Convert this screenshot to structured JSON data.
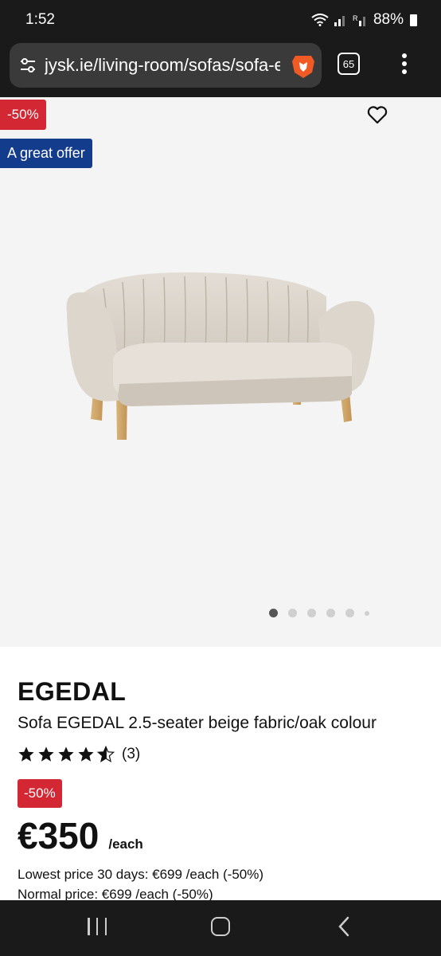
{
  "status_bar": {
    "time": "1:52",
    "battery": "88%"
  },
  "browser": {
    "url": "jysk.ie/living-room/sofas/sofa-egedal",
    "tab_count": "65"
  },
  "product": {
    "badge_discount": "-50%",
    "badge_offer": "A great offer",
    "gallery": {
      "image_count": 6,
      "active_index": 0
    },
    "brand": "EGEDAL",
    "title": "Sofa EGEDAL 2.5-seater beige fabric/oak colour",
    "rating": {
      "stars": 4.5,
      "count_text": "(3)"
    },
    "price_badge": "-50%",
    "price": "€350",
    "price_unit": "/each",
    "lowest_price": "Lowest price 30 days: €699 /each (-50%)",
    "normal_price": "Normal price: €699 /each (-50%)"
  },
  "colors": {
    "discount_red": "#d32733",
    "offer_blue": "#143c8c",
    "media_bg": "#f4f4f4"
  },
  "icons": [
    "tune-icon",
    "brave-lion-icon",
    "tabs-icon",
    "more-vert-icon",
    "heart-icon",
    "star-icon",
    "nav-recent-icon",
    "nav-home-icon",
    "nav-back-icon"
  ]
}
